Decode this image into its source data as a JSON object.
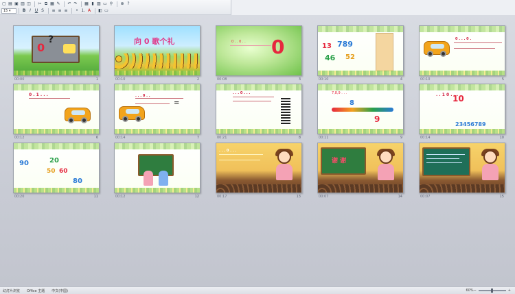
{
  "toolbar": {
    "font_size": "15",
    "row1_icons": [
      "file-new-icon",
      "open-icon",
      "save-icon",
      "print-icon",
      "preview-icon",
      "cut-icon",
      "copy-icon",
      "paste-icon",
      "format-painter-icon",
      "undo-icon",
      "redo-icon",
      "insert-table-icon",
      "insert-chart-icon",
      "insert-picture-icon",
      "insert-textbox-icon",
      "hyperlink-icon",
      "zoom-icon",
      "help-icon"
    ],
    "row2_icons": [
      "bold-icon",
      "italic-icon",
      "underline-icon",
      "shadow-icon",
      "align-left-icon",
      "align-center-icon",
      "align-right-icon",
      "bullets-icon",
      "numbering-icon",
      "font-color-icon",
      "design-icon",
      "new-slide-icon"
    ]
  },
  "slides": [
    {
      "n": "1",
      "time": "00:00",
      "label": "0 ?"
    },
    {
      "n": "2",
      "time": "00:10",
      "label": "向 0 歌个礼"
    },
    {
      "n": "3",
      "time": "00:08",
      "label": "0"
    },
    {
      "n": "4",
      "time": "00:10",
      "label": "13 789 46 52"
    },
    {
      "n": "5",
      "time": "00:10",
      "label": ""
    },
    {
      "n": "6",
      "time": "00:12",
      "label": "0"
    },
    {
      "n": "7",
      "time": "00:14",
      "label": "="
    },
    {
      "n": "8",
      "time": "00:21",
      "label": "0"
    },
    {
      "n": "9",
      "time": "00:11",
      "label": "7,8,9 9"
    },
    {
      "n": "10",
      "time": "00:14",
      "label": "10 23456789"
    },
    {
      "n": "11",
      "time": "00:20",
      "label": "90 20 60 50 80"
    },
    {
      "n": "12",
      "time": "00:12",
      "label": ""
    },
    {
      "n": "13",
      "time": "00:17",
      "label": ""
    },
    {
      "n": "14",
      "time": "00:07",
      "label": "谢 谢"
    },
    {
      "n": "15",
      "time": "00:07",
      "label": ""
    }
  ],
  "statusbar": {
    "view": "幻灯片浏览",
    "theme": "Office 主题",
    "language": "中文(中国)",
    "zoom": "60%"
  }
}
